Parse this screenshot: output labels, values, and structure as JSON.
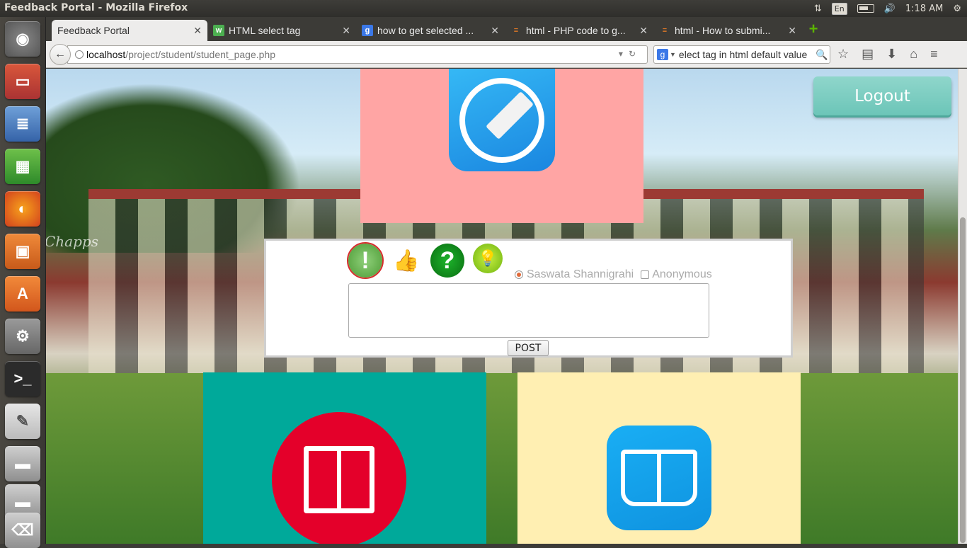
{
  "panel": {
    "window_title": "Feedback Portal - Mozilla Firefox",
    "language": "En",
    "clock": "1:18 AM"
  },
  "tabs": [
    {
      "label": "Feedback Portal",
      "icon": "none",
      "active": true
    },
    {
      "label": "HTML select tag",
      "icon": "w3schools-icon"
    },
    {
      "label": "how to get selected ...",
      "icon": "google-icon"
    },
    {
      "label": "html - PHP code to g...",
      "icon": "stackoverflow-icon"
    },
    {
      "label": "html - How to submi...",
      "icon": "stackoverflow-icon"
    }
  ],
  "url": {
    "host": "localhost",
    "path": "/project/student/student_page.php"
  },
  "search": {
    "value": "elect tag in html default value"
  },
  "page": {
    "logout_label": "Logout",
    "brand_text": "Chapps",
    "feedback": {
      "name_option": "Saswata Shannigrahi",
      "anonymous_option": "Anonymous",
      "post_label": "POST",
      "message": ""
    },
    "icons": {
      "type_issue": "exclamation-icon",
      "type_appreciation": "thumbs-up-icon",
      "type_question": "question-icon",
      "type_idea": "lightbulb-icon"
    }
  },
  "colors": {
    "tile_top": "#ffa5a4",
    "tile_left": "#00a99a",
    "tile_right": "#ffefb2",
    "logout": "#6cc5b8",
    "selected_outline": "#d62c2c"
  }
}
